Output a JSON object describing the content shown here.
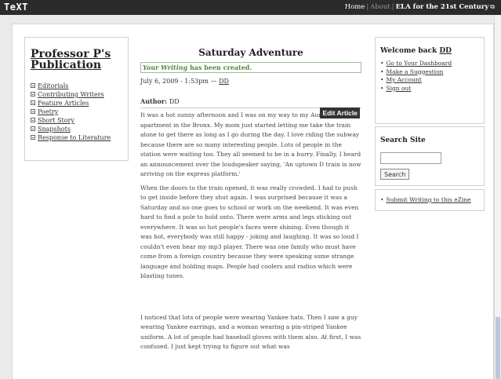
{
  "topbar": {
    "brand": "TeXT",
    "nav": {
      "home": "Home",
      "about": "About",
      "ela": "ELA for the 21st Century",
      "ext_icon": "⧉"
    }
  },
  "sidebar": {
    "title_line1": "Professor P's",
    "title_line2": "Publication",
    "items": [
      {
        "label": "Editorials"
      },
      {
        "label": "Contributing Writers"
      },
      {
        "label": "Feature Articles"
      },
      {
        "label": "Poetry"
      },
      {
        "label": "Short Story"
      },
      {
        "label": "Snapshots"
      },
      {
        "label": "Response to Literature"
      }
    ]
  },
  "article": {
    "title": "Saturday Adventure",
    "notice_prefix": "Your Writing",
    "notice_suffix": " has been created.",
    "date": "July 6, 2009 - 1:53pm — ",
    "date_author": "DD",
    "edit_label": "Edit Article",
    "author_label": "Author: ",
    "author_name": "DD",
    "paragraphs": [
      "It was a hot sunny afternoon and I was on my way to my Aunt Cecilia's apartment in the Bronx. My mom just started letting me take the train alone to get there as long as I go during the day. I love riding the subway because there are so many interesting people. Lots of people in the station were waiting too. They all seemed to be in a hurry. Finally, I heard an announcement over the loudspeaker saying, 'An uptown D train is now arriving on the express platform.'",
      "When the doors to the train opened, it was really crowded. I had to push to get inside before they shut again. I was surprised because it was a Saturday and no one goes to school or work on the weekend. It was even hard to find a pole to hold onto. There were arms and legs sticking out everywhere. It was so hot people's faces were shining. Even though it was hot, everybody was still happy - joking and laughing. It was so loud I couldn't even hear my mp3 player. There was one family who must have come from a foreign country because they were speaking some strange language and holding maps. People had coolers and radios which were blasting tunes.",
      "I noticed that lots of people were wearing Yankee hats.  Then I saw a guy wearing Yankee earrings, and a woman wearing a pin-striped Yankee uniform. A lot of people had baseball gloves with them also. At first, I was confused. I just kept trying to figure out what was"
    ]
  },
  "welcome": {
    "prefix": "Welcome back ",
    "user": "DD",
    "links": [
      {
        "label": "Go to Your Dashboard"
      },
      {
        "label": "Make a Suggestion"
      },
      {
        "label": "My Account"
      },
      {
        "label": "Sign out"
      }
    ]
  },
  "search": {
    "title": "Search Site",
    "button": "Search",
    "value": ""
  },
  "submit": {
    "label": "Submit Writing to this eZine"
  }
}
